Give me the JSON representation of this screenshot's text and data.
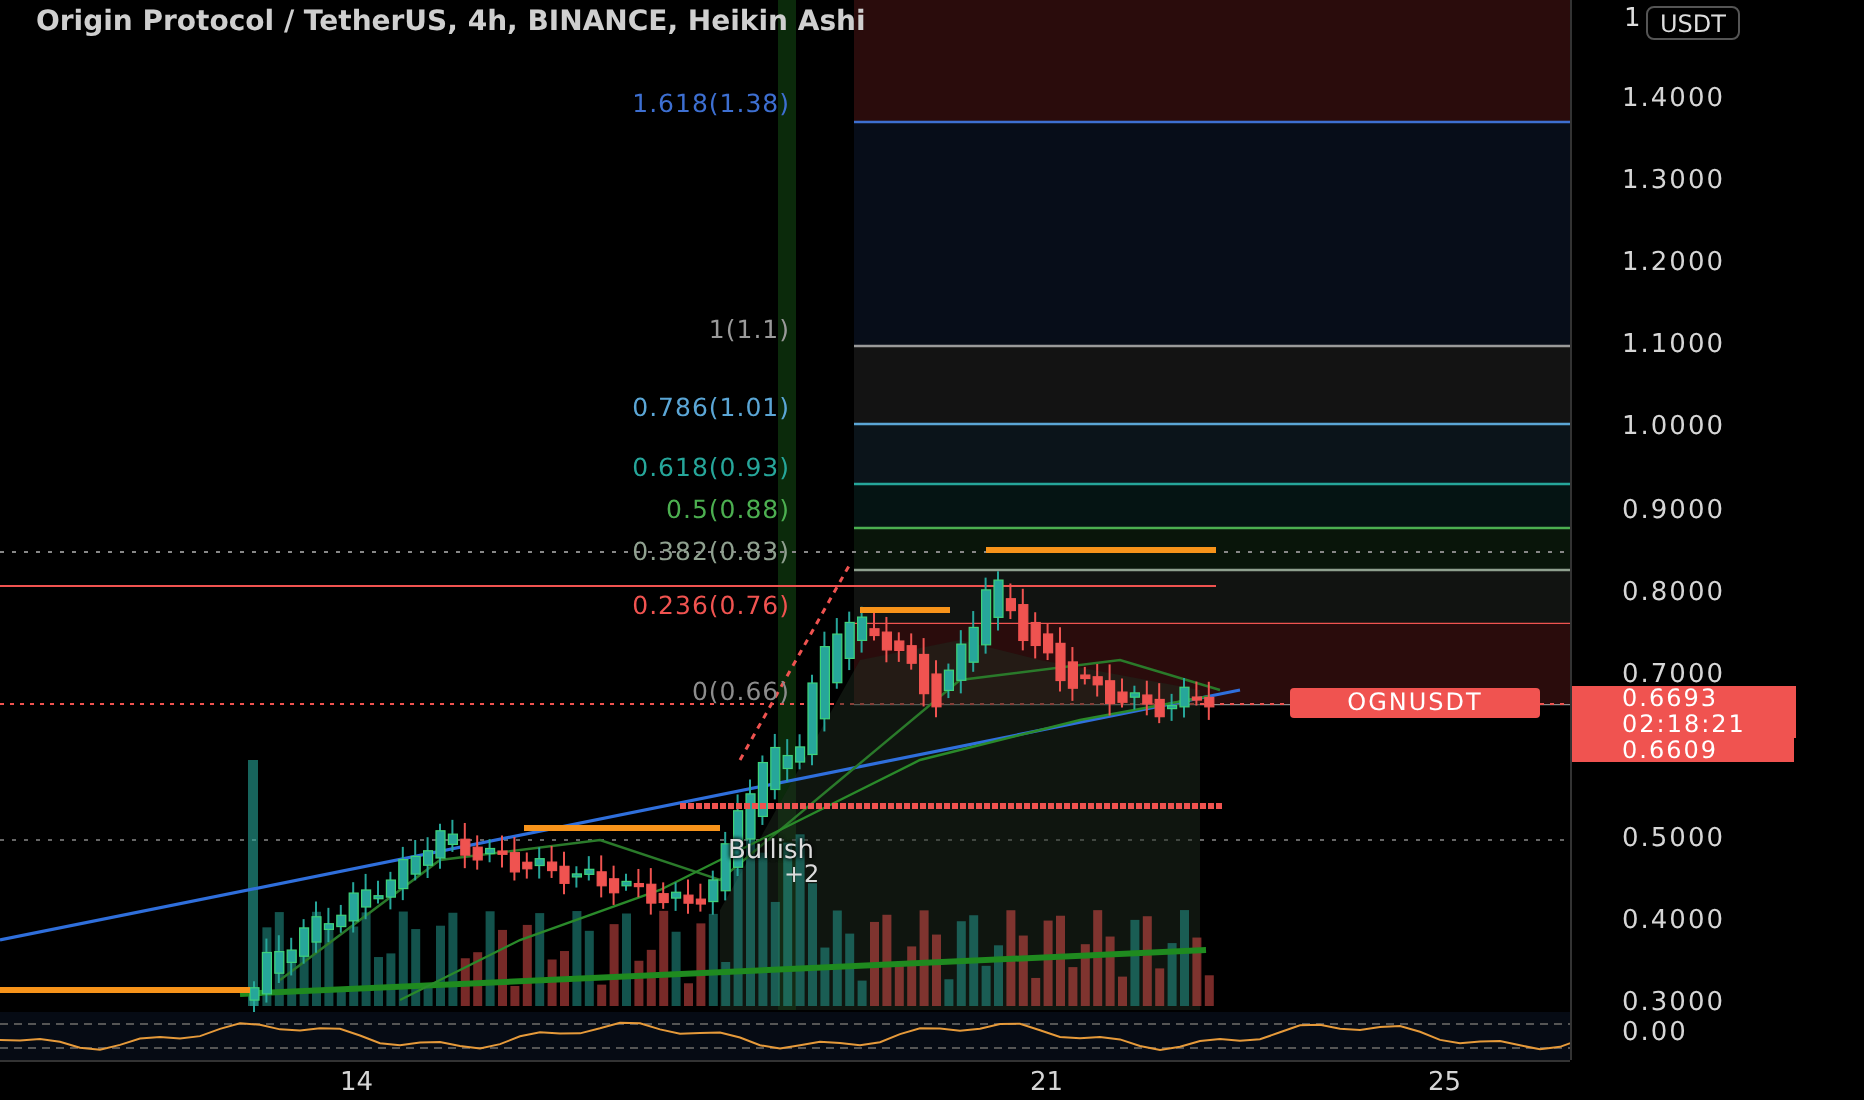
{
  "title": "Origin Protocol / TetherUS, 4h, BINANCE, Heikin Ashi",
  "fib_levels": [
    {
      "label": "1.618(1.38)",
      "color": "#3d6fd1"
    },
    {
      "label": "1(1.1)",
      "color": "#9a9a9a"
    },
    {
      "label": "0.786(1.01)",
      "color": "#5ba6d6"
    },
    {
      "label": "0.618(0.93)",
      "color": "#26a69a"
    },
    {
      "label": "0.5(0.88)",
      "color": "#4caf50"
    },
    {
      "label": "0.382(0.83)",
      "color": "#8fa08f"
    },
    {
      "label": "0.236(0.76)",
      "color": "#f05350"
    },
    {
      "label": "0(0.66)",
      "color": "#8c8c8c"
    }
  ],
  "signal": {
    "label": "Bullish",
    "count": "+2"
  },
  "symbol_tag": "OGNUSDT",
  "price_tag": {
    "price": "0.6693",
    "countdown": "02:18:21"
  },
  "secondary_price_tag": "0.6609",
  "price_axis": {
    "partial_label": "1",
    "currency": "USDT",
    "labels": [
      "1.4000",
      "1.3000",
      "1.2000",
      "1.1000",
      "1.0000",
      "0.9000",
      "0.8000",
      "0.7000",
      "0.5000",
      "0.4000",
      "0.3000"
    ]
  },
  "oscillator_axis_label": "0.00",
  "time_axis": [
    "14",
    "21",
    "25"
  ]
}
